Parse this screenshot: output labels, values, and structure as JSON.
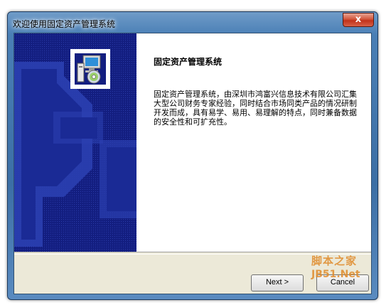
{
  "window": {
    "title": "欢迎使用固定资产管理系统",
    "close_glyph": "x"
  },
  "content": {
    "title": "固定资产管理系统",
    "description": "固定资产管理系统，由深圳市鸿富兴信息技术有限公司汇集大型公司财务专家经验，同时结合市场同类产品的情况研制开发而成，具有易学、易用、易理解的特点，同时兼备数据的安全性和可扩充性。"
  },
  "buttons": {
    "next": "Next >",
    "cancel": "Cancel"
  },
  "watermark": {
    "site_name": "脚本之家",
    "site_domain": "JB51.Net"
  },
  "icons": {
    "installer": "installer-computer-cd-icon"
  }
}
